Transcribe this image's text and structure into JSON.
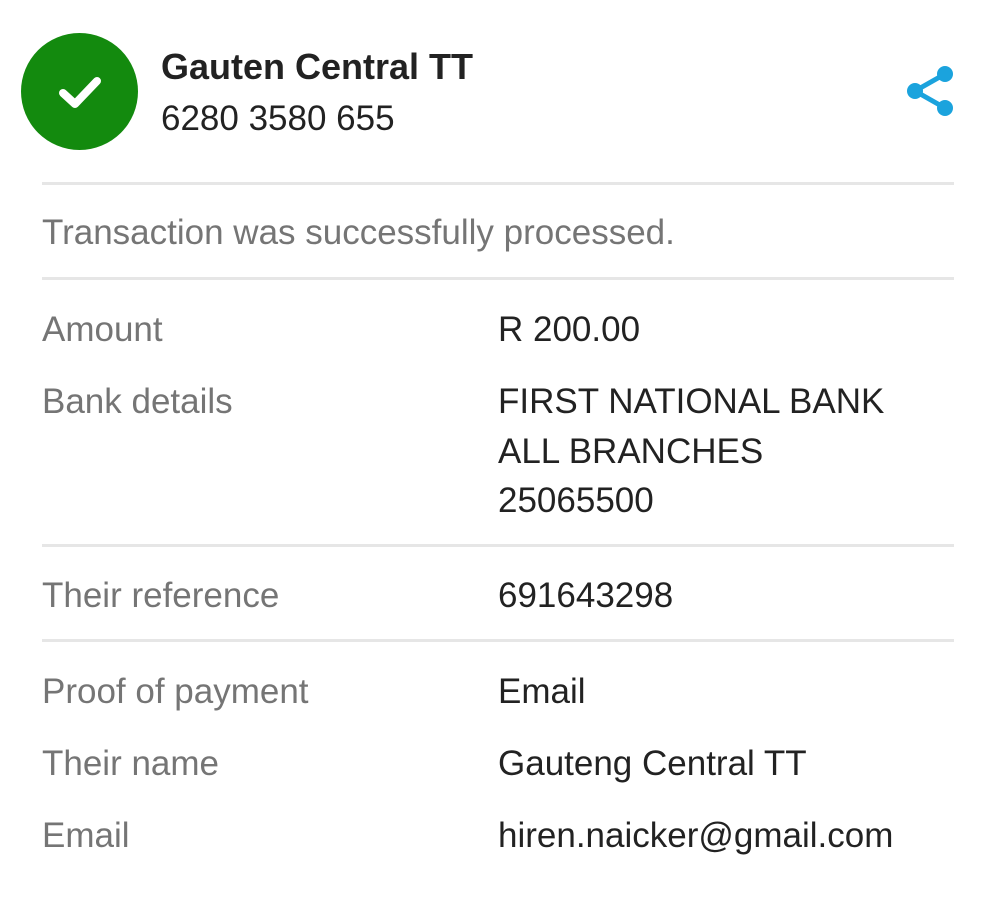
{
  "header": {
    "recipient_name": "Gauten Central TT",
    "account_number": "6280 3580 655",
    "status_icon": "check-icon",
    "share_icon": "share-icon",
    "status_color": "#138a0e",
    "accent_color": "#1ba3dd"
  },
  "status_message": "Transaction was successfully processed.",
  "details": {
    "amount": {
      "label": "Amount",
      "value": "R 200.00"
    },
    "bank_details": {
      "label": "Bank details",
      "bank_name": "FIRST NATIONAL BANK",
      "branch": "ALL BRANCHES",
      "branch_code": "25065500"
    },
    "their_reference": {
      "label": "Their reference",
      "value": "691643298"
    },
    "proof_of_payment": {
      "label": "Proof of payment",
      "value": "Email"
    },
    "their_name": {
      "label": "Their name",
      "value": "Gauteng Central TT"
    },
    "email": {
      "label": "Email",
      "value": "hiren.naicker@gmail.com"
    }
  }
}
